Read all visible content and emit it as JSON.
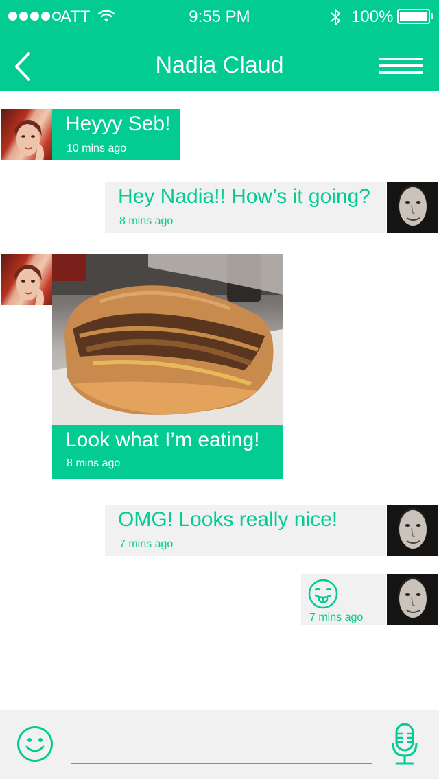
{
  "status_bar": {
    "carrier": "ATT",
    "time": "9:55 PM",
    "battery_percent": "100%",
    "signal_filled": 4,
    "signal_total": 5
  },
  "header": {
    "title": "Nadia Claud",
    "back_icon": "chevron-left-icon",
    "menu_icon": "menu-icon"
  },
  "messages": [
    {
      "sender": "Nadia",
      "direction": "incoming",
      "text": "Heyyy Seb!",
      "time": "10 mins ago"
    },
    {
      "sender": "Seb",
      "direction": "outgoing",
      "text": "Hey Nadia!! How’s it going?",
      "time": "8 mins ago"
    },
    {
      "sender": "Nadia",
      "direction": "incoming",
      "has_photo": true,
      "text": "Look what I’m eating!",
      "time": "8 mins ago"
    },
    {
      "sender": "Seb",
      "direction": "outgoing",
      "text": "OMG! Looks really nice!",
      "time": "7 mins ago"
    },
    {
      "sender": "Seb",
      "direction": "outgoing",
      "emoji": "tongue-out-face-icon",
      "time": "7 mins ago"
    }
  ],
  "composer": {
    "emoji_icon": "smiley-icon",
    "mic_icon": "microphone-icon",
    "input_value": "",
    "placeholder": ""
  },
  "colors": {
    "accent": "#02cc92",
    "outgoing_bubble": "#f1f1f1",
    "composer_bg": "#f1f1f1"
  }
}
